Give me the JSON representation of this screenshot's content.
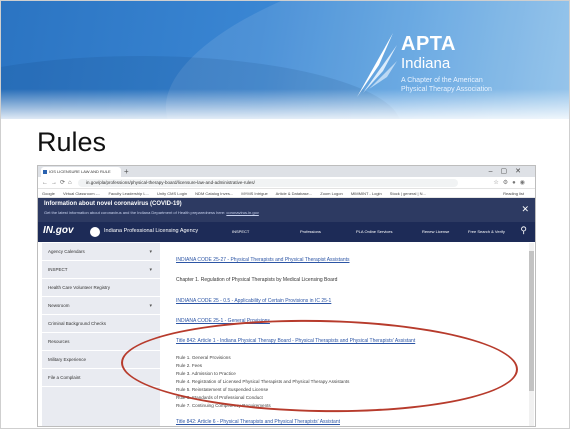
{
  "slide": {
    "title": "Rules",
    "logo": {
      "apta": "APTA",
      "indiana": "Indiana",
      "tagline_1": "A Chapter of the American",
      "tagline_2": "Physical Therapy Association"
    }
  },
  "browser": {
    "tab_label": "IOS LICENSURE LAW AND RULE",
    "url": "in.gov/pla/professions/physical-therapy-board/licensure-law-and-administrative-rules/",
    "bookmarks": [
      "Google",
      "Virtual Classroom -...",
      "Faculty Leadership L...",
      "Unity CMS Login",
      "NDM Catalog Inves...",
      "MYMS Intrigue",
      "Article & Database...",
      "Zoom Logon",
      "MIMMINT - Login",
      "Stock | general | N..."
    ],
    "bookmarks_other": "Reading list"
  },
  "covid_banner": {
    "heading": "Information about novel coronavirus (COVID-19)",
    "sub": "Get the latest information about coronavirus and the Indiana Department of Health preparedness here:",
    "sub_link": "coronavirus.in.gov"
  },
  "ingov": {
    "brand": "IN.gov",
    "agency": "Indiana Professional Licensing Agency",
    "nav": [
      "INSPECT",
      "Professions",
      "PLA Online Services",
      "Renew License",
      "Free Search & Verify"
    ]
  },
  "sidebar": {
    "items": [
      {
        "label": "Agency Calendars",
        "caret": "▾"
      },
      {
        "label": "INSPECT",
        "caret": "▾"
      },
      {
        "label": "Health Care Volunteer Registry",
        "caret": ""
      },
      {
        "label": "Newsroom",
        "caret": "▾"
      },
      {
        "label": "Criminal Background Checks",
        "caret": ""
      },
      {
        "label": "Resources",
        "caret": ""
      },
      {
        "label": "Military Experience",
        "caret": ""
      },
      {
        "label": "File a Complaint",
        "caret": ""
      }
    ]
  },
  "content": {
    "link_1": "INDIANA CODE 25-27 - Physical Therapists and Physical Therapist Assistants",
    "text_1": "Chapter 1. Regulation of Physical Therapists by Medical Licensing Board",
    "link_2": "INDIANA CODE 25 - 0.5 - Applicability of Certain Provisions in IC 25-1",
    "link_3": "INDIANA CODE 25-1 - General Provisions",
    "link_4": "Title 842: Article 1 - Indiana Physical Therapy Board - Physical Therapists and Physical Therapists' Assistant",
    "rules": [
      "Rule 1. General Provisions",
      "Rule 2. Fees",
      "Rule 3. Admission to Practice",
      "Rule 4. Registration of Licensed Physical Therapists and Physical Therapy Assistants",
      "Rule 5. Reinstatement of Suspended License",
      "Rule 6. Standards of Professional Conduct",
      "Rule 7. Continuing Competency Requirements"
    ],
    "link_5": "Title 842: Article 6 - Physical Therapists and Physical Therapists' Assistant"
  },
  "colors": {
    "band": "#3a86d3",
    "covid_bg": "#2d3a62",
    "ingov_bg": "#1d2b57",
    "link": "#2c55a5",
    "annotation": "#b73b2c"
  }
}
